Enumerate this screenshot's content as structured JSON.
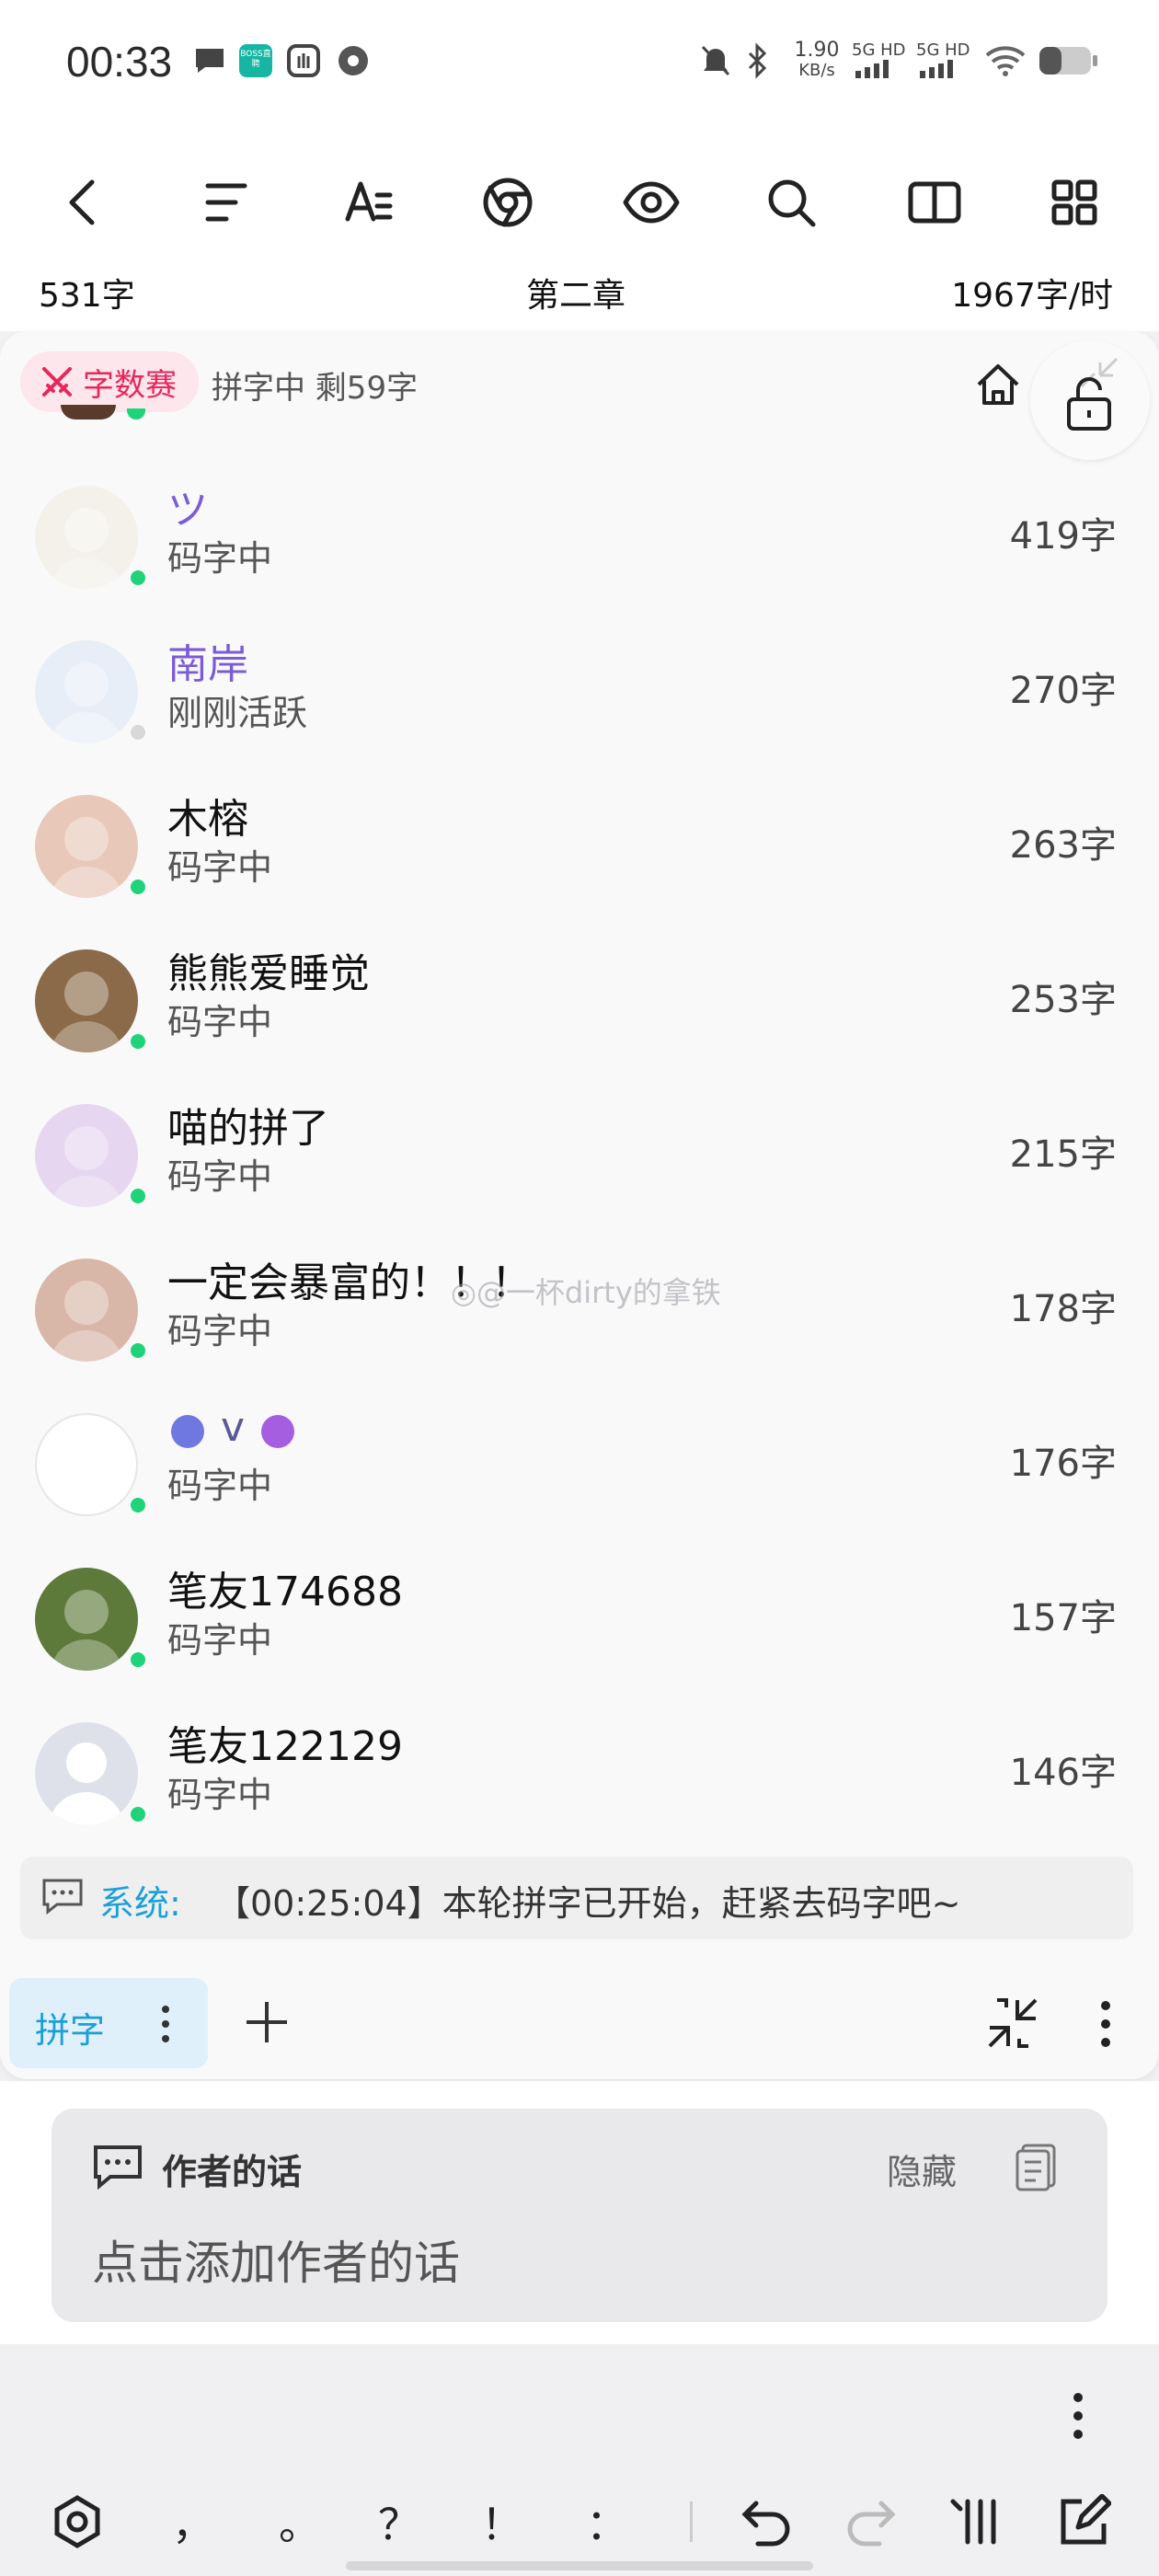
{
  "status_bar": {
    "time": "00:33",
    "boss_label": "BOSS直聘",
    "net_speed": "1.90",
    "net_unit": "KB/s",
    "sig1": "5G HD",
    "sig2": "5G HD"
  },
  "stats": {
    "word_count": "531字",
    "chapter": "第二章",
    "speed": "1967字/时"
  },
  "race": {
    "badge_label": "字数赛",
    "status": "拼字中 剩59字"
  },
  "participants": [
    {
      "name": "ツ",
      "status": "码字中",
      "count": "419字",
      "online": true,
      "name_color": "#7b5cd6",
      "avatar_bg": "#f4f1ea"
    },
    {
      "name": "南岸",
      "status": "刚刚活跃",
      "count": "270字",
      "online": false,
      "name_color": "#7b5cd6",
      "avatar_bg": "#e8eef8"
    },
    {
      "name": "木榕",
      "status": "码字中",
      "count": "263字",
      "online": true,
      "name_color": "#111111",
      "avatar_bg": "#e8c8b8"
    },
    {
      "name": "熊熊爱睡觉",
      "status": "码字中",
      "count": "253字",
      "online": true,
      "name_color": "#111111",
      "avatar_bg": "#8a6a48"
    },
    {
      "name": "喵的拼了",
      "status": "码字中",
      "count": "215字",
      "online": true,
      "name_color": "#111111",
      "avatar_bg": "#e6d6f0"
    },
    {
      "name": "一定会暴富的！！！",
      "status": "码字中",
      "count": "178字",
      "online": true,
      "name_color": "#111111",
      "avatar_bg": "#d9b7a8"
    },
    {
      "name": "v",
      "status": "码字中",
      "count": "176字",
      "online": true,
      "name_color": "#5a5a9a",
      "avatar_bg": "#ffffff"
    },
    {
      "name": "笔友174688",
      "status": "码字中",
      "count": "157字",
      "online": true,
      "name_color": "#111111",
      "avatar_bg": "#5d7a3a"
    },
    {
      "name": "笔友122129",
      "status": "码字中",
      "count": "146字",
      "online": true,
      "name_color": "#111111",
      "avatar_bg": "#dfe1ea"
    }
  ],
  "system_message": {
    "label": "系统:",
    "text": "【00:25:04】本轮拼字已开始，赶紧去码字吧~"
  },
  "watermark": "@一杯dirty的拿铁",
  "tabs": {
    "active_label": "拼字"
  },
  "author_note": {
    "title": "作者的话",
    "hide_label": "隐藏",
    "placeholder": "点击添加作者的话"
  },
  "keyboard_bar": {
    "keys": [
      "，",
      "。",
      "？",
      "！",
      "："
    ]
  },
  "colors": {
    "accent_pink": "#e8265a",
    "online_green": "#1fd37a",
    "system_blue": "#1aa0d8"
  }
}
